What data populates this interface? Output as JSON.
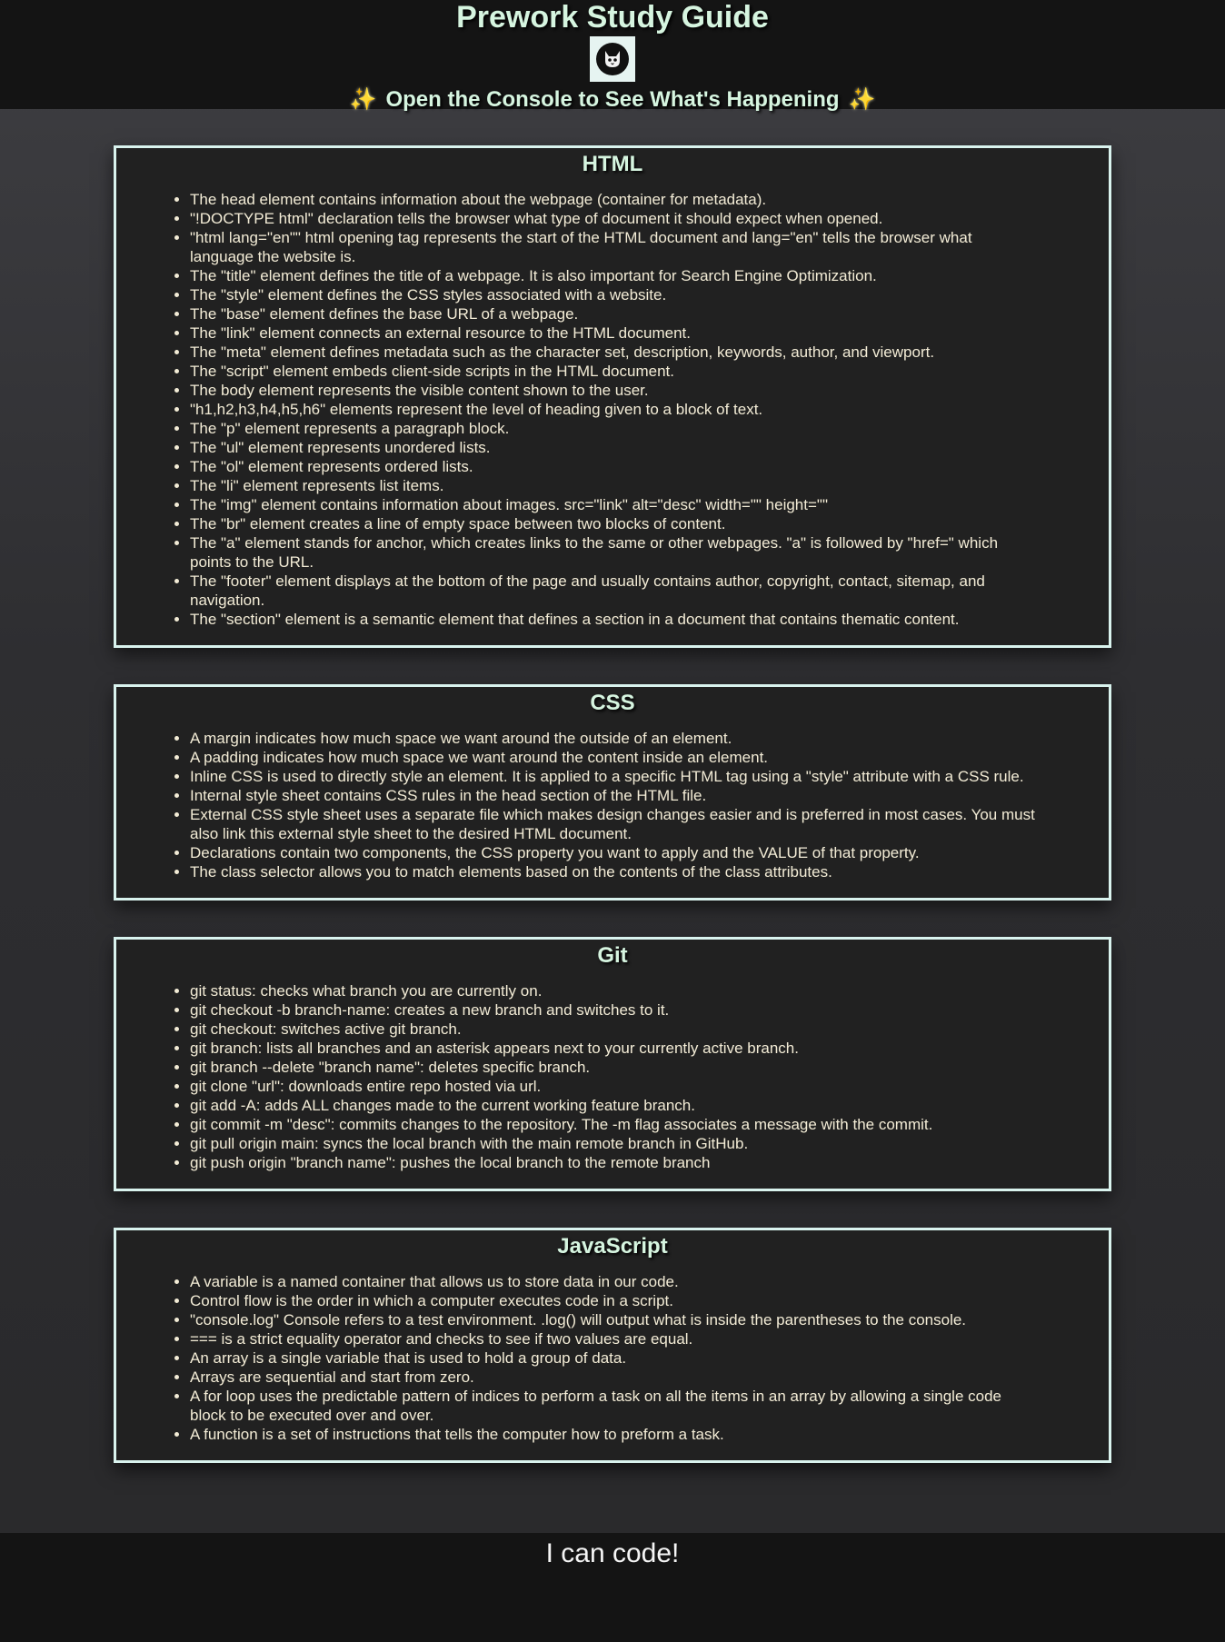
{
  "header": {
    "title": "Prework Study Guide",
    "logo_icon": "cat-logo-icon",
    "subtitle": "Open the Console to See What's Happening",
    "sparkle_glyph": "✨"
  },
  "sections": [
    {
      "title": "HTML",
      "items": [
        "The head element contains information about the webpage (container for metadata).",
        "\"!DOCTYPE html\" declaration tells the browser what type of document it should expect when opened.",
        "\"html lang=\"en\"\" html opening tag represents the start of the HTML document and lang=\"en\" tells the browser what language the website is.",
        "The \"title\" element defines the title of a webpage. It is also important for Search Engine Optimization.",
        "The \"style\" element defines the CSS styles associated with a website.",
        "The \"base\" element defines the base URL of a webpage.",
        "The \"link\" element connects an external resource to the HTML document.",
        "The \"meta\" element defines metadata such as the character set, description, keywords, author, and viewport.",
        "The \"script\" element embeds client-side scripts in the HTML document.",
        "The body element represents the visible content shown to the user.",
        "\"h1,h2,h3,h4,h5,h6\" elements represent the level of heading given to a block of text.",
        "The \"p\" element represents a paragraph block.",
        "The \"ul\" element represents unordered lists.",
        "The \"ol\" element represents ordered lists.",
        "The \"li\" element represents list items.",
        "The \"img\" element contains information about images. src=\"link\" alt=\"desc\" width=\"\" height=\"\"",
        "The \"br\" element creates a line of empty space between two blocks of content.",
        "The \"a\" element stands for anchor, which creates links to the same or other webpages. \"a\" is followed by \"href=\" which points to the URL.",
        "The \"footer\" element displays at the bottom of the page and usually contains author, copyright, contact, sitemap, and navigation.",
        "The \"section\" element is a semantic element that defines a section in a document that contains thematic content."
      ]
    },
    {
      "title": "CSS",
      "items": [
        "A margin indicates how much space we want around the outside of an element.",
        "A padding indicates how much space we want around the content inside an element.",
        "Inline CSS is used to directly style an element. It is applied to a specific HTML tag using a \"style\" attribute with a CSS rule.",
        "Internal style sheet contains CSS rules in the head section of the HTML file.",
        "External CSS style sheet uses a separate file which makes design changes easier and is preferred in most cases. You must also link this external style sheet to the desired HTML document.",
        "Declarations contain two components, the CSS property you want to apply and the VALUE of that property.",
        "The class selector allows you to match elements based on the contents of the class attributes."
      ]
    },
    {
      "title": "Git",
      "items": [
        "git status: checks what branch you are currently on.",
        "git checkout -b branch-name: creates a new branch and switches to it.",
        "git checkout: switches active git branch.",
        "git branch: lists all branches and an asterisk appears next to your currently active branch.",
        "git branch --delete \"branch name\": deletes specific branch.",
        "git clone \"url\": downloads entire repo hosted via url.",
        "git add -A: adds ALL changes made to the current working feature branch.",
        "git commit -m \"desc\": commits changes to the repository. The -m flag associates a message with the commit.",
        "git pull origin main: syncs the local branch with the main remote branch in GitHub.",
        "git push origin \"branch name\": pushes the local branch to the remote branch"
      ]
    },
    {
      "title": "JavaScript",
      "items": [
        "A variable is a named container that allows us to store data in our code.",
        "Control flow is the order in which a computer executes code in a script.",
        "\"console.log\" Console refers to a test environment. .log() will output what is inside the parentheses to the console.",
        "=== is a strict equality operator and checks to see if two values are equal.",
        "An array is a single variable that is used to hold a group of data.",
        "Arrays are sequential and start from zero.",
        "A for loop uses the predictable pattern of indices to perform a task on all the items in an array by allowing a single code block to be executed over and over.",
        "A function is a set of instructions that tells the computer how to preform a task."
      ]
    }
  ],
  "footer": {
    "text": "I can code!"
  }
}
